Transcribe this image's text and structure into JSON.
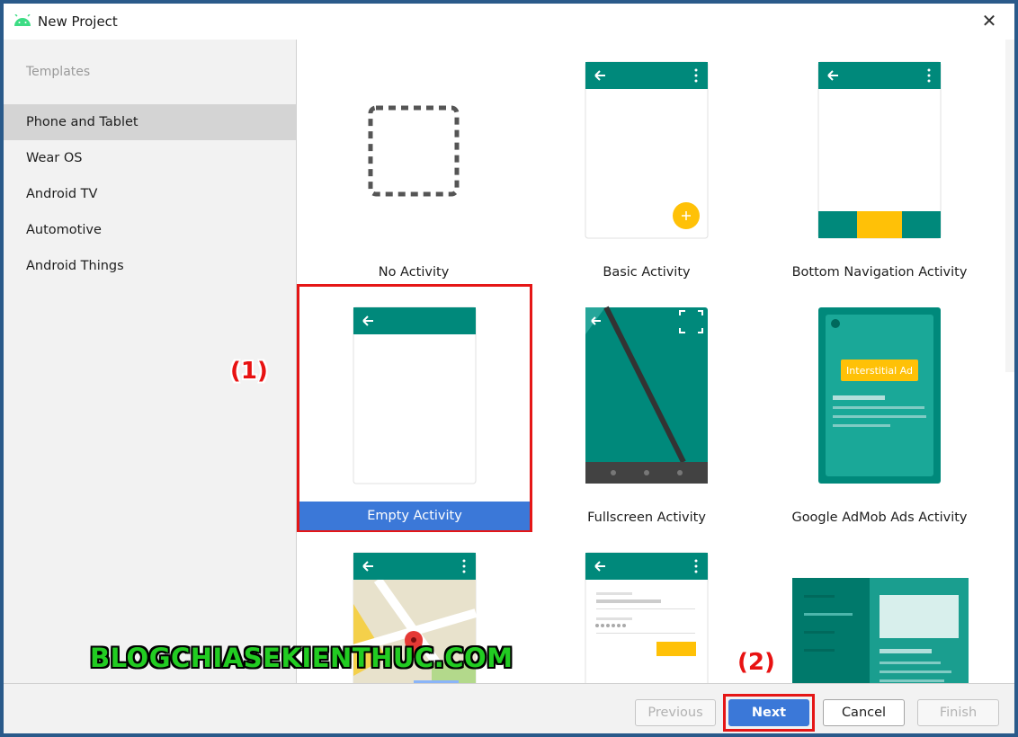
{
  "window": {
    "title": "New Project"
  },
  "sidebar": {
    "section_label": "Templates",
    "items": [
      {
        "label": "Phone and Tablet",
        "selected": true
      },
      {
        "label": "Wear OS"
      },
      {
        "label": "Android TV"
      },
      {
        "label": "Automotive"
      },
      {
        "label": "Android Things"
      }
    ]
  },
  "templates": [
    {
      "label": "No Activity"
    },
    {
      "label": "Basic Activity"
    },
    {
      "label": "Bottom Navigation Activity"
    },
    {
      "label": "Empty Activity",
      "selected": true
    },
    {
      "label": "Fullscreen Activity"
    },
    {
      "label": "Google AdMob Ads Activity",
      "ad_label": "Interstitial Ad"
    },
    {
      "label": ""
    },
    {
      "label": ""
    },
    {
      "label": ""
    }
  ],
  "annotations": {
    "one": "(1)",
    "two": "(2)"
  },
  "watermark": "BLOGCHIASEKIENTHUC.COM",
  "footer": {
    "previous_label": "Previous",
    "next_label": "Next",
    "cancel_label": "Cancel",
    "finish_label": "Finish"
  },
  "colors": {
    "teal": "#00897b",
    "teal_light": "#26a69a",
    "accent_yellow": "#ffc107",
    "selection_blue": "#3b78d8",
    "highlight_red": "#e51616",
    "watermark_green": "#22cc22"
  }
}
